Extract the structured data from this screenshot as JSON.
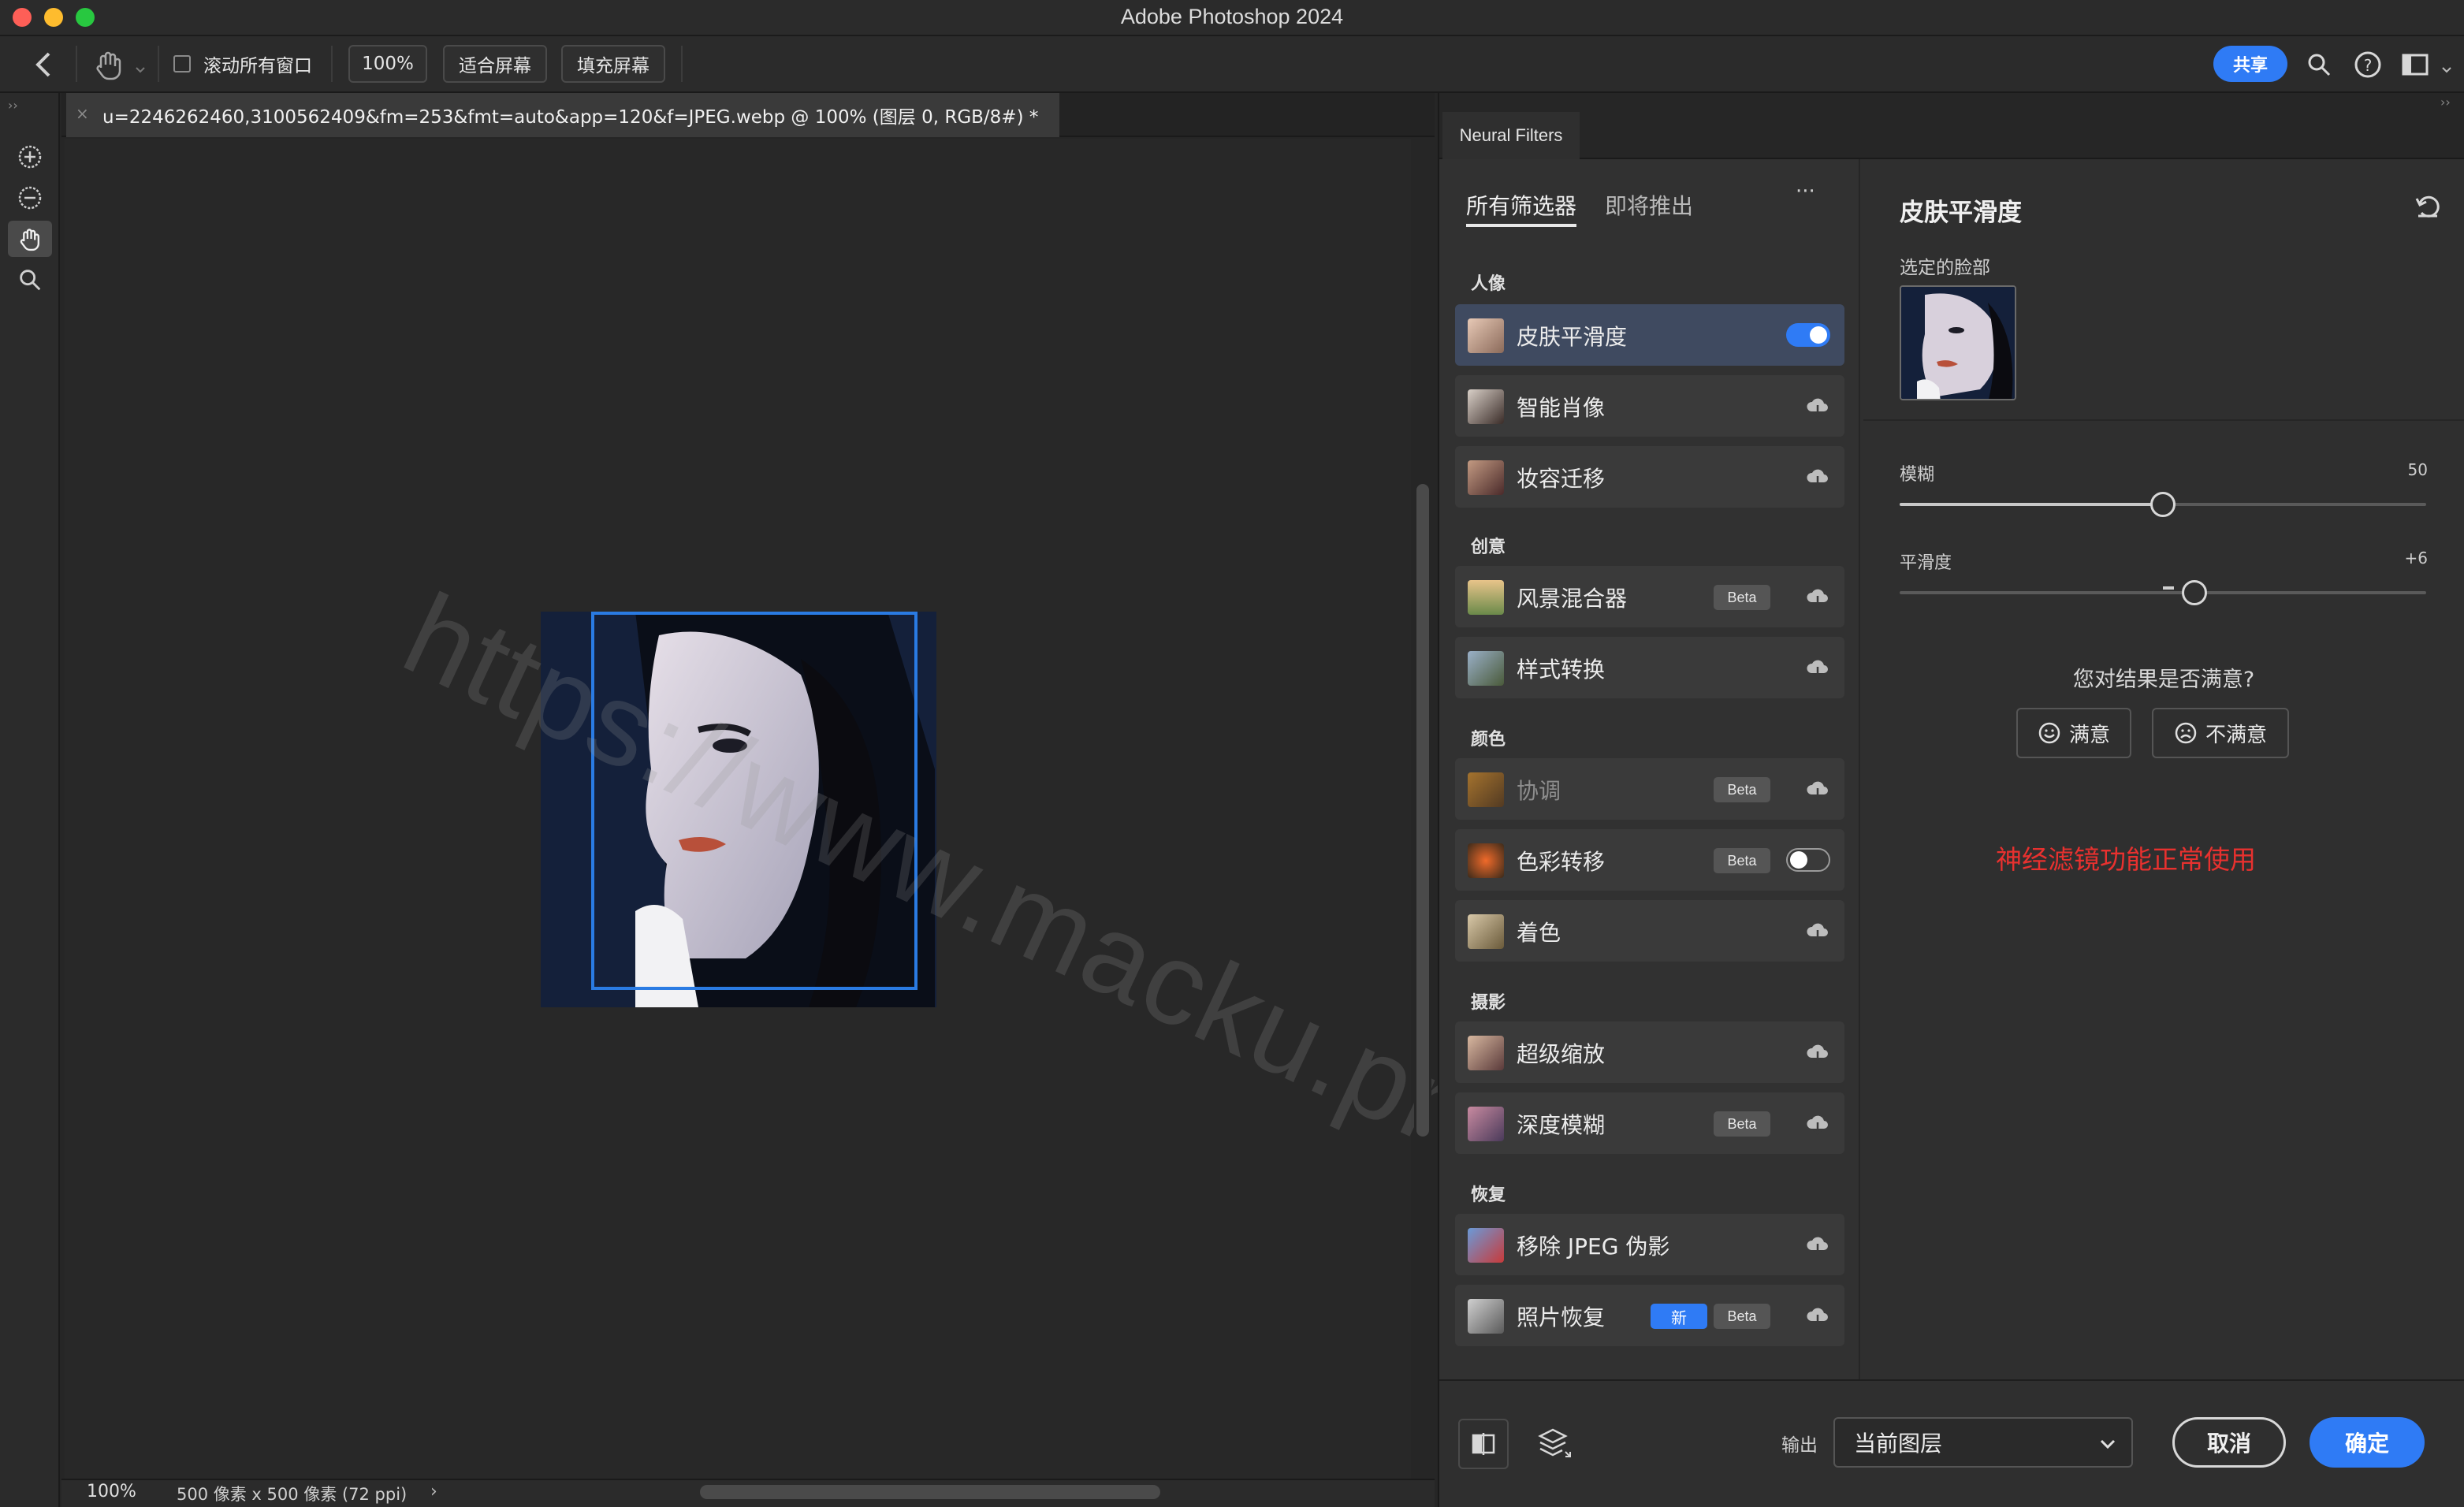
{
  "window": {
    "title": "Adobe Photoshop 2024"
  },
  "options_bar": {
    "scroll_all_label": "滚动所有窗口",
    "zoom_100_label": "100%",
    "fit_screen_label": "适合屏幕",
    "fill_screen_label": "填充屏幕",
    "share_label": "共享"
  },
  "document": {
    "tab_title": "u=2246262460,3100562409&fm=253&fmt=auto&app=120&f=JPEG.webp @ 100% (图层 0, RGB/8#) *",
    "zoom": "100%",
    "size_info": "500 像素 x 500 像素 (72 ppi)",
    "watermark": "https://www.macku.pro/"
  },
  "neural_filters": {
    "panel_tab": "Neural Filters",
    "tab_all": "所有筛选器",
    "tab_coming": "即将推出",
    "more": "···",
    "sections": [
      {
        "title": "人像",
        "items": [
          {
            "label": "皮肤平滑度",
            "state": "toggle-on"
          },
          {
            "label": "智能肖像",
            "state": "cloud"
          },
          {
            "label": "妆容迁移",
            "state": "cloud"
          }
        ]
      },
      {
        "title": "创意",
        "items": [
          {
            "label": "风景混合器",
            "badge": "Beta",
            "state": "cloud"
          },
          {
            "label": "样式转换",
            "state": "cloud"
          }
        ]
      },
      {
        "title": "颜色",
        "items": [
          {
            "label": "协调",
            "badge": "Beta",
            "state": "cloud",
            "dim": true
          },
          {
            "label": "色彩转移",
            "badge": "Beta",
            "state": "toggle-off"
          },
          {
            "label": "着色",
            "state": "cloud"
          }
        ]
      },
      {
        "title": "摄影",
        "items": [
          {
            "label": "超级缩放",
            "state": "cloud"
          },
          {
            "label": "深度模糊",
            "badge": "Beta",
            "state": "cloud"
          }
        ]
      },
      {
        "title": "恢复",
        "items": [
          {
            "label": "移除 JPEG 伪影",
            "state": "cloud"
          },
          {
            "label": "照片恢复",
            "new_badge": "新",
            "badge": "Beta",
            "state": "cloud"
          }
        ]
      }
    ],
    "settings": {
      "title": "皮肤平滑度",
      "selected_face_label": "选定的脸部",
      "blur_label": "模糊",
      "blur_value": "50",
      "blur_fraction": 0.5,
      "smooth_label": "平滑度",
      "smooth_value": "+6",
      "smooth_fraction": 0.56,
      "satisfaction_question": "您对结果是否满意?",
      "satisfied_label": "满意",
      "unsatisfied_label": "不满意",
      "annotation": "神经滤镜功能正常使用",
      "annotation_color": "#e8312f"
    },
    "output_label": "输出",
    "output_value": "当前图层",
    "cancel_label": "取消",
    "ok_label": "确定"
  }
}
